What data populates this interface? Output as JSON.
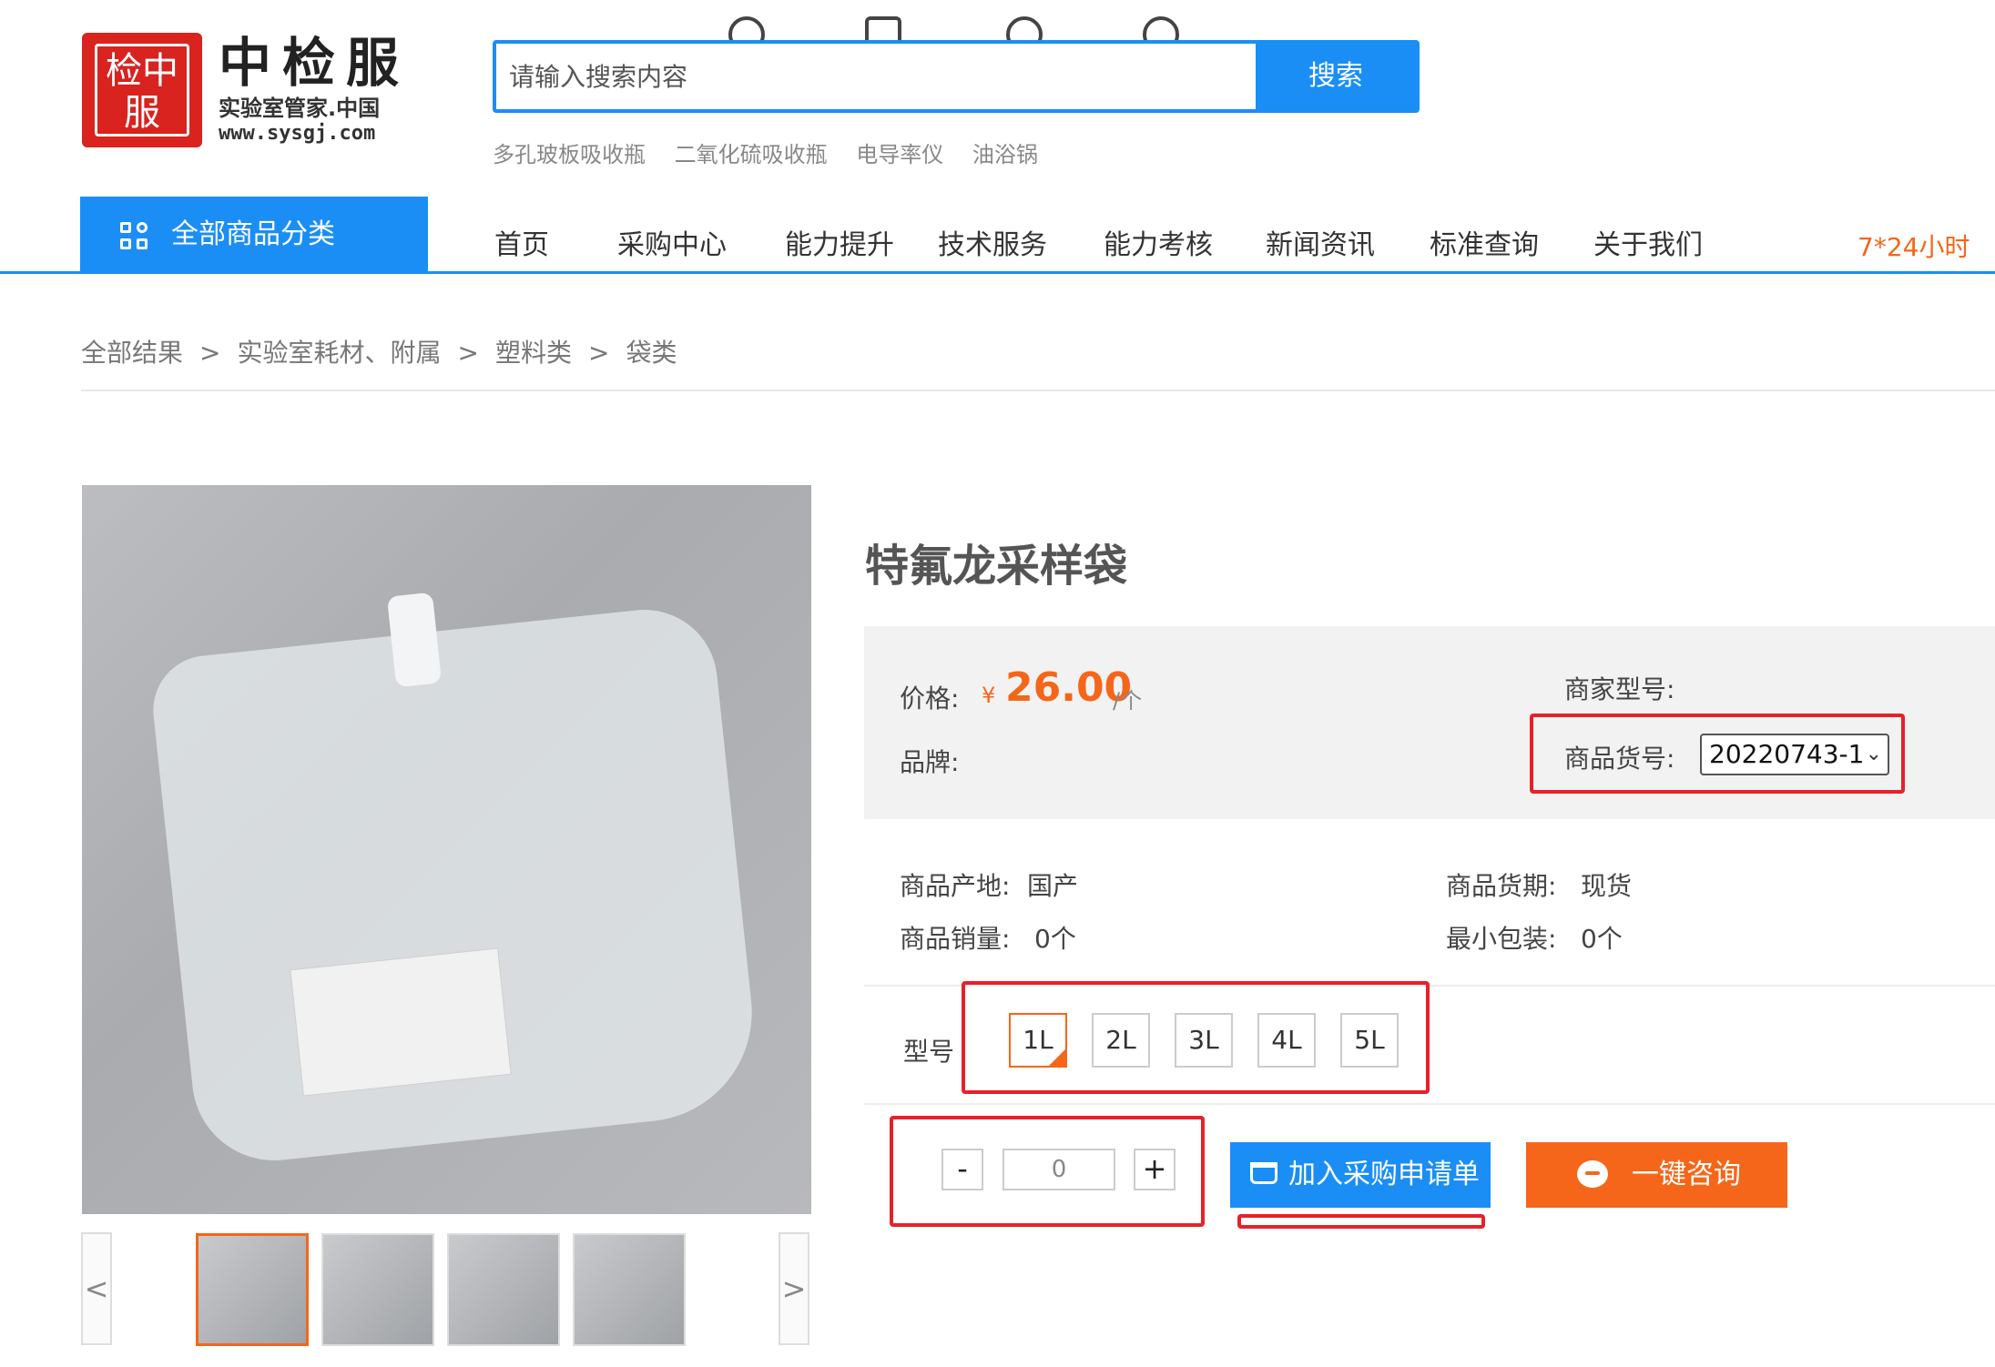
{
  "logo": {
    "seal": "检中服"
  },
  "brand": {
    "name": "中检服",
    "tagline": "实验室管家.中国",
    "url": "www.sysgj.com"
  },
  "search": {
    "placeholder": "请输入搜索内容",
    "button": "搜索"
  },
  "hot_searches": [
    "多孔玻板吸收瓶",
    "二氧化硫吸收瓶",
    "电导率仪",
    "油浴锅"
  ],
  "nav": {
    "category_button": "全部商品分类",
    "items": [
      "首页",
      "采购中心",
      "能力提升",
      "技术服务",
      "能力考核",
      "新闻资讯",
      "标准查询",
      "关于我们"
    ],
    "service": "7*24小时"
  },
  "breadcrumb": [
    "全部结果",
    "实验室耗材、附属",
    "塑料类",
    "袋类"
  ],
  "breadcrumb_sep": ">",
  "gallery": {
    "prev": "<",
    "next": ">",
    "thumb_count": 4
  },
  "product": {
    "title": "特氟龙采样袋",
    "price_label": "价格:",
    "currency": "¥",
    "price": "26.00",
    "unit": "/个",
    "brand_label": "品牌:",
    "merchant_model_label": "商家型号:",
    "sku_label": "商品货号:",
    "sku_value": "20220743-1",
    "origin_label": "商品产地:",
    "origin": "国产",
    "delivery_label": "商品货期:",
    "delivery": "现货",
    "sales_label": "商品销量:",
    "sales": "0个",
    "min_pack_label": "最小包装:",
    "min_pack": "0个",
    "variant_label": "型号",
    "variants": [
      "1L",
      "2L",
      "3L",
      "4L",
      "5L"
    ],
    "selected_variant": "1L",
    "quantity": "0",
    "qty_minus": "-",
    "qty_plus": "+",
    "add_button": "加入采购申请单",
    "consult_button": "一键咨询"
  },
  "colors": {
    "accent": "#1a8ef5",
    "price": "#f5661a",
    "annotation": "#e8202a"
  }
}
